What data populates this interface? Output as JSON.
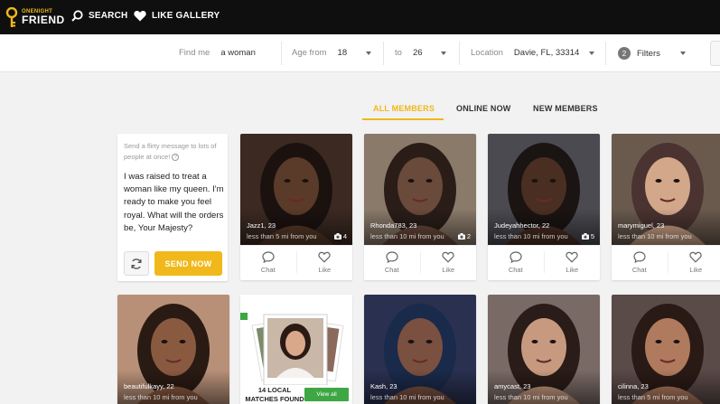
{
  "header": {
    "logo_top": "ONENIGHT",
    "logo_bottom": "FRIEND",
    "search_label": "SEARCH",
    "gallery_label": "LIKE GALLERY"
  },
  "filters": {
    "find_me_label": "Find me",
    "find_me_value": "a woman",
    "age_from_label": "Age from",
    "age_from_value": "18",
    "age_to_label": "to",
    "age_to_value": "26",
    "location_label": "Location",
    "location_value": "Davie, FL, 33314",
    "filters_count": "2",
    "filters_label": "Filters"
  },
  "tabs": [
    {
      "label": "ALL MEMBERS",
      "active": true
    },
    {
      "label": "ONLINE NOW",
      "active": false
    },
    {
      "label": "NEW MEMBERS",
      "active": false
    }
  ],
  "message_card": {
    "hint": "Send a flirty message to lots of people at once!",
    "message": "I was raised to treat a woman like my queen. I'm ready to make you feel royal. What will the orders be, Your Majesty?",
    "send_label": "SEND NOW"
  },
  "action_labels": {
    "chat": "Chat",
    "like": "Like"
  },
  "profiles_row1": [
    {
      "name": "Jazz1, 23",
      "distance": "less than 5 mi from you",
      "photos": "4",
      "skin": "#5a3a28",
      "hair": "#1b1210",
      "bg": "#3c2a22"
    },
    {
      "name": "Rhonda783, 23",
      "distance": "less than 10 mi from you",
      "photos": "2",
      "skin": "#6a4a3a",
      "hair": "#2a1d18",
      "bg": "#8a7a6a"
    },
    {
      "name": "Judeyahhector, 22",
      "distance": "less than 10 mi from you",
      "photos": "5",
      "skin": "#4a2e22",
      "hair": "#1a1412",
      "bg": "#4b4a50"
    },
    {
      "name": "marymiguel, 23",
      "distance": "less than 10 mi from you",
      "photos": "",
      "skin": "#d2a78a",
      "hair": "#4a3330",
      "bg": "#6a5a4e"
    }
  ],
  "profiles_row2": [
    {
      "name": "beautifulkayy, 22",
      "distance": "less than 10 mi from you",
      "skin": "#8a5a40",
      "hair": "#2a1a14",
      "bg": "#b89078"
    },
    {
      "name": "Kash, 23",
      "distance": "less than 10 mi from you",
      "skin": "#7a5040",
      "hair": "#1a2a4a",
      "bg": "#2a3050"
    },
    {
      "name": "amycast, 23",
      "distance": "less than 10 mi from you",
      "skin": "#c79a80",
      "hair": "#2a1c18",
      "bg": "#7a6a66"
    },
    {
      "name": "cilinna, 23",
      "distance": "less than 5 mi from you",
      "skin": "#b07a5e",
      "hair": "#2a1a16",
      "bg": "#5a4a48"
    }
  ],
  "promo": {
    "text": "14 LOCAL MATCHES FOUND",
    "view_all": "View all"
  },
  "colors": {
    "accent": "#f0b81a",
    "green": "#3ea744",
    "topbar": "#0f0f0f"
  }
}
